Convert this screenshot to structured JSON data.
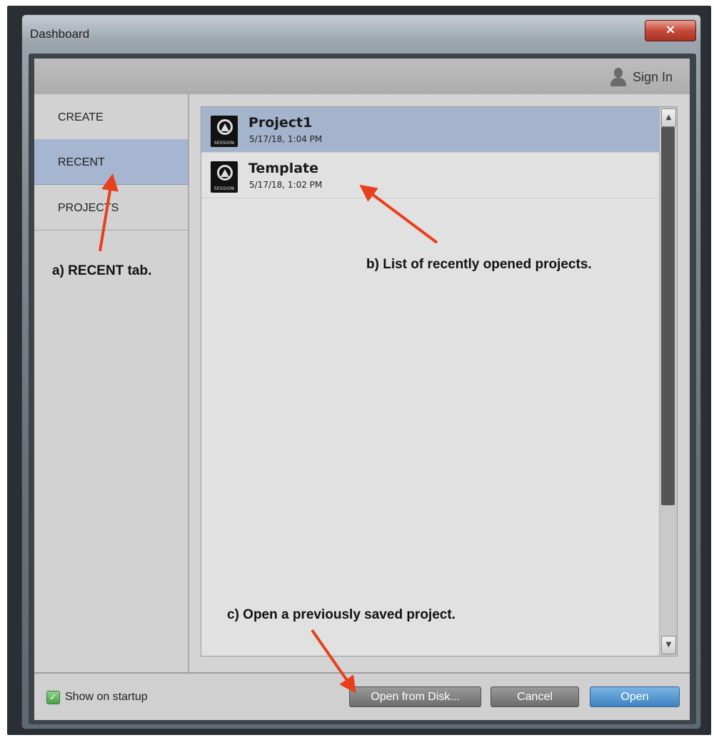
{
  "window": {
    "title": "Dashboard",
    "close_glyph": "×"
  },
  "header": {
    "sign_in_label": "Sign In",
    "sign_in_icon": "user-icon"
  },
  "sidebar": {
    "tabs": [
      {
        "label": "CREATE",
        "active": false
      },
      {
        "label": "RECENT",
        "active": true
      },
      {
        "label": "PROJECTS",
        "active": false
      }
    ]
  },
  "recent_list": {
    "items": [
      {
        "name": "Project1",
        "date": "5/17/18, 1:04 PM",
        "icon": "session-icon",
        "icon_label": "SESSION",
        "selected": true
      },
      {
        "name": "Template",
        "date": "5/17/18, 1:02 PM",
        "icon": "session-icon",
        "icon_label": "SESSION",
        "selected": false
      }
    ]
  },
  "footer": {
    "show_on_startup_label": "Show on startup",
    "show_on_startup_checked": true,
    "open_from_disk_label": "Open from Disk...",
    "cancel_label": "Cancel",
    "open_label": "Open"
  },
  "annotations": {
    "a": "a) RECENT tab.",
    "b": "b) List of recently opened projects.",
    "c": "c) Open a previously saved project."
  },
  "colors": {
    "selection": "#a5b4cd",
    "primary_button": "#4a8ccb",
    "arrow": "#e8401c"
  }
}
